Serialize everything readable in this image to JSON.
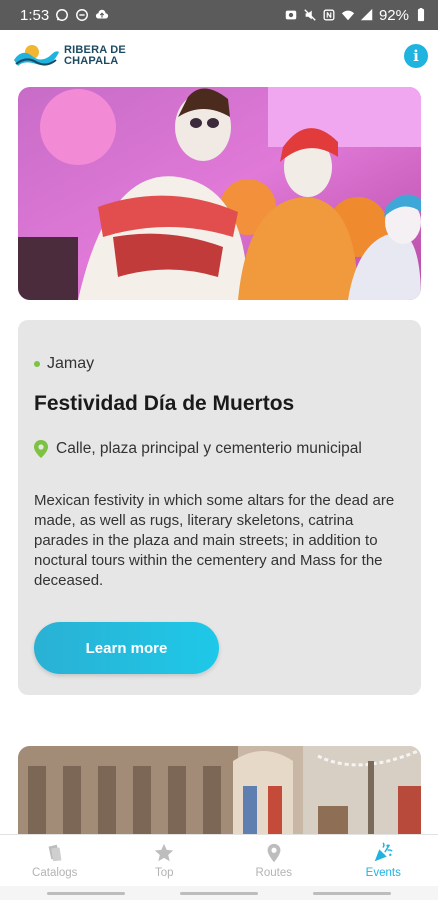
{
  "status_bar": {
    "time": "1:53",
    "battery": "92%",
    "left_icons": [
      "whatsapp-icon",
      "minus-circle-icon",
      "cloud-upload-icon"
    ],
    "right_icons": [
      "alarm-icon",
      "mute-icon",
      "nfc-icon",
      "wifi-icon",
      "signal-icon",
      "battery-icon"
    ]
  },
  "header": {
    "logo_line1": "RIBERA DE",
    "logo_line2": "CHAPALA",
    "info_label": "i"
  },
  "event": {
    "town": "Jamay",
    "title": "Festividad Día de Muertos",
    "location": "Calle, plaza principal y cementerio municipal",
    "description": "Mexican festivity in which some altars for the dead are made, as well as rugs, literary skeletons, catrina parades in the plaza and main streets; in addition to noctural tours within the cementery and Mass for the deceased.",
    "cta_label": "Learn more"
  },
  "bottom_nav": {
    "items": [
      {
        "label": "Catalogs",
        "icon": "catalog-icon"
      },
      {
        "label": "Top",
        "icon": "star-icon"
      },
      {
        "label": "Routes",
        "icon": "map-pin-icon"
      },
      {
        "label": "Events",
        "icon": "party-popper-icon"
      }
    ],
    "active_index": 3
  },
  "colors": {
    "accent": "#1fb3e0",
    "town_dot": "#7dc242",
    "card_bg": "#e6e6e6",
    "status_bar_bg": "#5b5b5b"
  }
}
